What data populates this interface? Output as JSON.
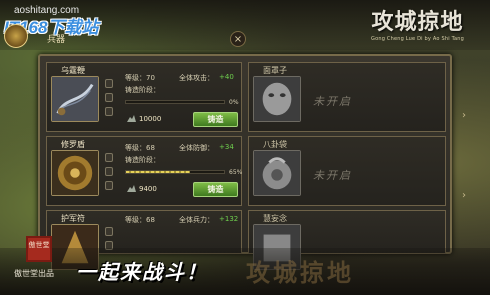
{
  "watermark": {
    "url": "aoshitang.com",
    "logo": "IT168下载站"
  },
  "header": {
    "tab_label": "兵器",
    "close": "×"
  },
  "game_logo": {
    "title": "攻城掠地",
    "subtitle": "Gong Cheng Lue Di by Ao Shi Tang"
  },
  "items": [
    {
      "name": "乌霆鞭",
      "level": "等级：70",
      "stat_label": "全体攻击：",
      "stat_value": "+40",
      "progress_label": "铸造阶段：",
      "progress_pct": 0,
      "progress_text": "0%",
      "cost": "10000",
      "button": "铸造"
    },
    {
      "name": "修罗盾",
      "level": "等级：68",
      "stat_label": "全体防御：",
      "stat_value": "+34",
      "progress_label": "铸造阶段：",
      "progress_pct": 65,
      "progress_text": "65%",
      "cost": "9400",
      "button": "铸造"
    },
    {
      "name": "护军符",
      "level": "等级：68",
      "stat_label": "全体兵力：",
      "stat_value": "+132"
    }
  ],
  "locked_items": [
    {
      "name": "面罩子",
      "status": "未开启"
    },
    {
      "name": "八卦袋",
      "status": "未开启"
    },
    {
      "name": "慧妄念",
      "status": ""
    }
  ],
  "footer": {
    "seal_text": "傲世堂",
    "seal_caption": "傲世堂出品",
    "slogan": "一起来战斗！",
    "slogan_bg": "攻城掠地"
  }
}
